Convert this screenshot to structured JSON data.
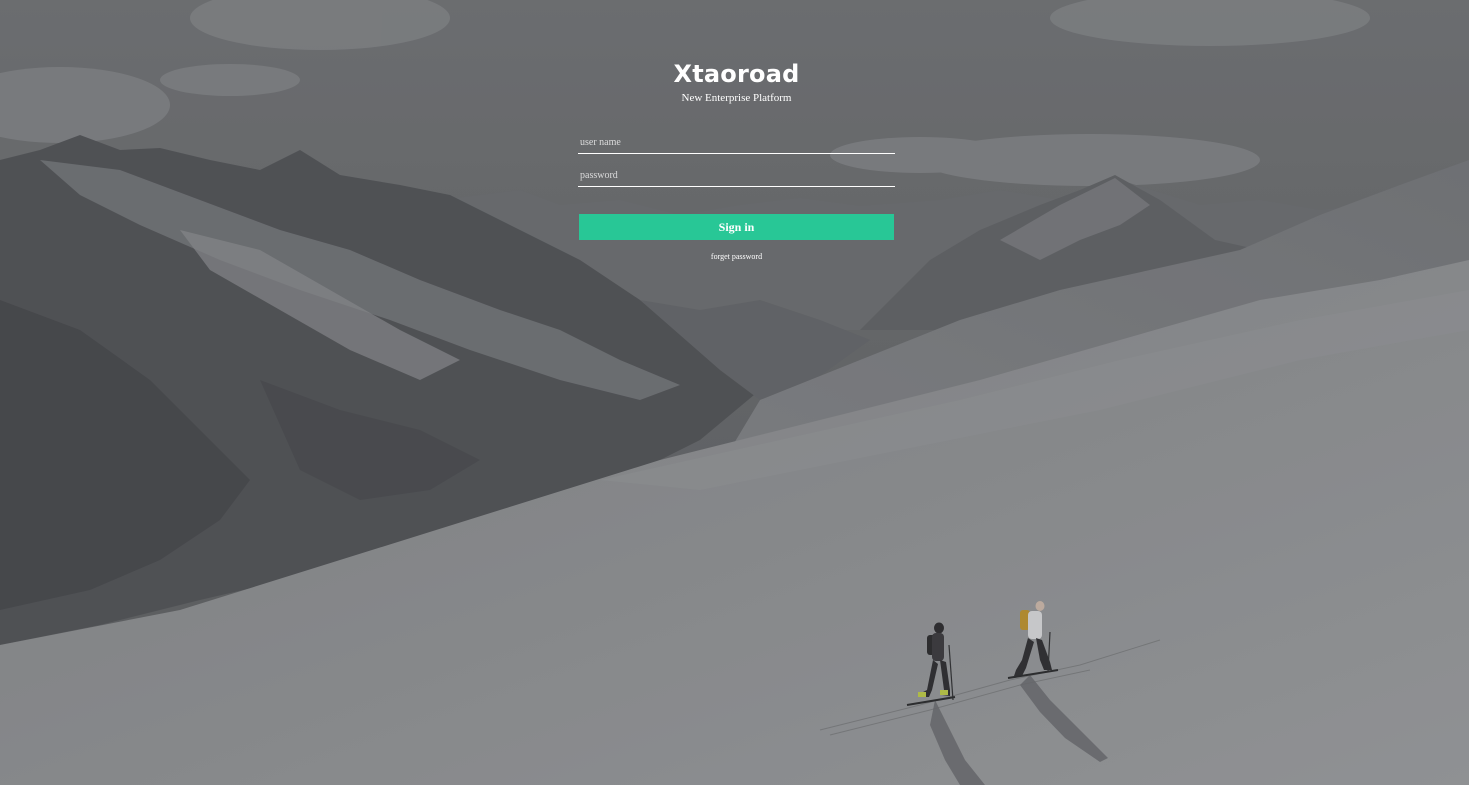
{
  "brand": {
    "title": "Xtaoroad",
    "subtitle": "New Enterprise Platform"
  },
  "form": {
    "username_placeholder": "user name",
    "password_placeholder": "password",
    "username_value": "",
    "password_value": "",
    "signin_label": "Sign in",
    "forget_label": "forget password"
  },
  "colors": {
    "accent": "#28c796",
    "overlay": "#5f6063",
    "text": "#ffffff"
  },
  "background": {
    "scene": "snowy-mountains-with-two-ski-tourers"
  }
}
